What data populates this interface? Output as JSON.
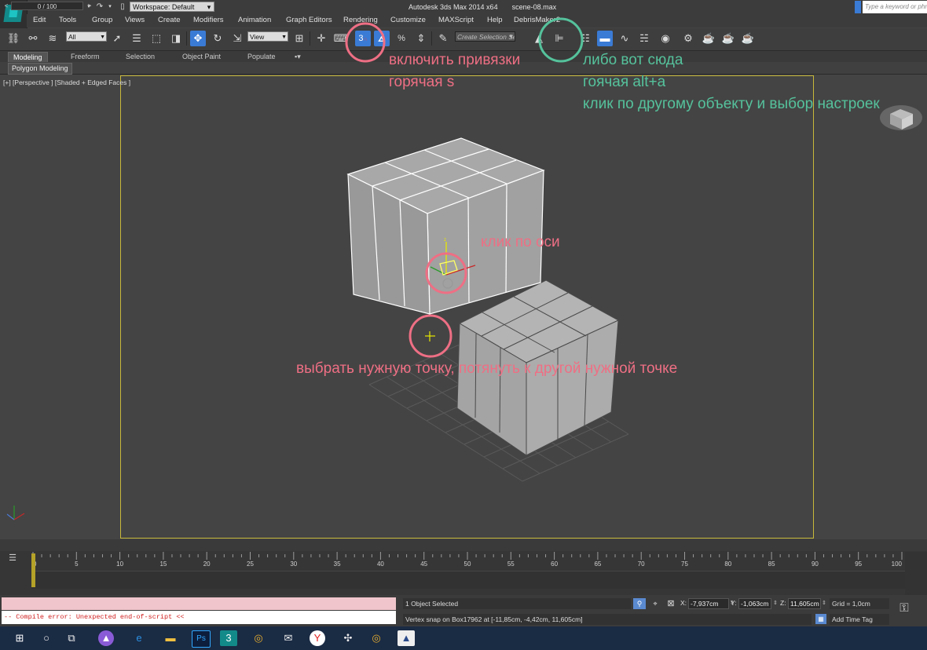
{
  "window": {
    "app": "Autodesk 3ds Max  2014 x64",
    "file": "scene-08.max",
    "workspace": "Workspace: Default",
    "search_placeholder": "Type a keyword or phrase"
  },
  "menu": [
    "Edit",
    "Tools",
    "Group",
    "Views",
    "Create",
    "Modifiers",
    "Animation",
    "Graph Editors",
    "Rendering",
    "Customize",
    "MAXScript",
    "Help",
    "DebrisMaker2"
  ],
  "toolbar": {
    "selection_filter": "All",
    "ref_coord": "View",
    "snap_label": "3",
    "named_selection_placeholder": "Create Selection Se"
  },
  "ribbon": {
    "tabs": [
      "Modeling",
      "Freeform",
      "Selection",
      "Object Paint",
      "Populate"
    ],
    "panel_label": "Polygon Modeling"
  },
  "viewport": {
    "label": "[+] [Perspective ] [Shaded + Edged Faces ]"
  },
  "annotations": {
    "snaps_line1": "включить привязки",
    "snaps_line2": "горячая s",
    "align_line1": "либо вот сюда",
    "align_line2": "гоячая alt+a",
    "align_line3": "клик по другому объекту и выбор настроек",
    "axis_click": "клик по оси",
    "pick_point": "выбрать нужную точку, потянуть к другой нужной точке"
  },
  "annotation_colors": {
    "pink": "#ee6f84",
    "green": "#55c29c"
  },
  "timeslider": {
    "value": "0 / 100",
    "prev": "<",
    "next": ">"
  },
  "trackbar": {
    "ticks": [
      "0",
      "5",
      "10",
      "15",
      "20",
      "25",
      "30",
      "35",
      "40",
      "45",
      "50",
      "55",
      "60",
      "65",
      "70",
      "75",
      "80",
      "85",
      "90",
      "95",
      "100"
    ]
  },
  "status": {
    "maxscript_error": "-- Compile error: Unexpected end-of-script  <<",
    "selected": "1 Object Selected",
    "prompt": "Vertex snap on Box17962 at [-11,85cm, -4,42cm, 11,605cm]",
    "x_label": "X:",
    "x_value": "-7,937cm",
    "y_label": "Y:",
    "y_value": "-1,063cm",
    "z_label": "Z:",
    "z_value": "11,605cm",
    "grid": "Grid = 1,0cm",
    "add_time_tag": "Add Time Tag"
  },
  "icons": [
    "app-logo-icon",
    "new-file-icon",
    "open-file-icon",
    "save-icon",
    "undo-icon",
    "redo-icon",
    "link-icon",
    "unlink-icon",
    "bind-spacewarp-icon",
    "select-object-icon",
    "select-by-name-icon",
    "rect-region-icon",
    "window-crossing-icon",
    "move-icon",
    "rotate-icon",
    "scale-icon",
    "pivot-icon",
    "manipulate-icon",
    "keyboard-shortcut-icon",
    "snap-3d-icon",
    "angle-snap-icon",
    "percent-snap-icon",
    "spinner-snap-icon",
    "edit-named-sel-icon",
    "mirror-icon",
    "align-icon",
    "layer-manager-icon",
    "ribbon-icon",
    "curve-editor-icon",
    "schematic-icon",
    "material-editor-icon",
    "render-setup-icon",
    "render-frame-icon",
    "render-icon",
    "key-icon",
    "windows-start-icon",
    "cortana-icon",
    "task-view-icon"
  ]
}
